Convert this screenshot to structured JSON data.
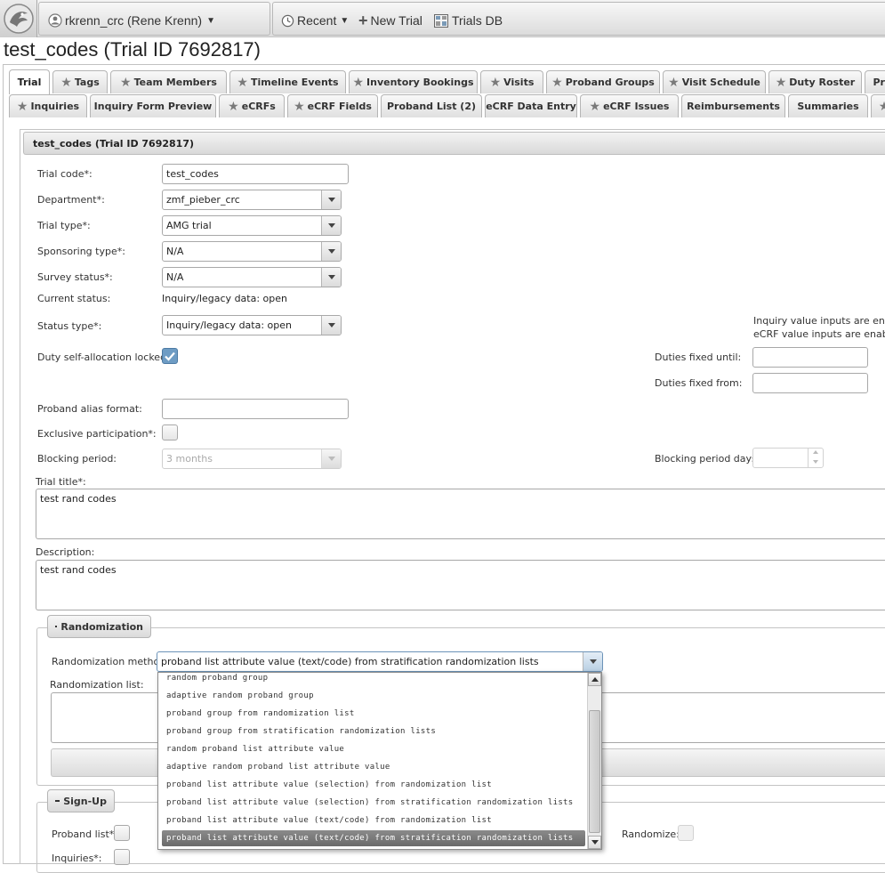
{
  "topbar": {
    "user": "rkrenn_crc (Rene Krenn)",
    "recent": "Recent",
    "new_trial": "New Trial",
    "trials_db": "Trials DB"
  },
  "page_title": "test_codes (Trial ID 7692817)",
  "tabs_row1": [
    "Trial",
    "Tags",
    "Team Members",
    "Timeline Events",
    "Inventory Bookings",
    "Visits",
    "Proband Groups",
    "Visit Schedule",
    "Duty Roster",
    "Pro"
  ],
  "tabs_row2": [
    "Inquiries",
    "Inquiry Form Preview",
    "eCRFs",
    "eCRF Fields",
    "Proband List (2)",
    "eCRF Data Entry",
    "eCRF Issues",
    "Reimbursements",
    "Summaries"
  ],
  "active_tab": "Trial",
  "section_title": "test_codes (Trial ID 7692817)",
  "form": {
    "trial_code_label": "Trial code*:",
    "trial_code_value": "test_codes",
    "department_label": "Department*:",
    "department_value": "zmf_pieber_crc",
    "trial_type_label": "Trial type*:",
    "trial_type_value": "AMG trial",
    "sponsoring_label": "Sponsoring type*:",
    "sponsoring_value": "N/A",
    "survey_label": "Survey status*:",
    "survey_value": "N/A",
    "current_status_label": "Current status:",
    "current_status_value": "Inquiry/legacy data: open",
    "status_type_label": "Status type*:",
    "status_type_value": "Inquiry/legacy data: open",
    "status_note_1": "Inquiry value inputs are enable",
    "status_note_2": "eCRF value inputs are enabled",
    "duty_locked_label": "Duty self-allocation locked*:",
    "duty_locked_checked": true,
    "duties_until_label": "Duties fixed until:",
    "duties_from_label": "Duties fixed from:",
    "alias_label": "Proband alias format:",
    "alias_value": "",
    "exclusive_label": "Exclusive participation*:",
    "exclusive_checked": false,
    "blocking_label": "Blocking period:",
    "blocking_value": "3 months",
    "blocking_days_label": "Blocking period days:",
    "title_label": "Trial title*:",
    "title_value": "test rand codes",
    "description_label": "Description:",
    "description_value": "test rand codes"
  },
  "randomization": {
    "legend": "Randomization",
    "method_label": "Randomization method:",
    "method_value": "proband list attribute value (text/code) from stratification randomization lists",
    "list_label": "Randomization list:",
    "options": [
      "random proband group",
      "adaptive random proband group",
      "proband group from randomization list",
      "proband group from stratification randomization lists",
      "random proband list attribute value",
      "adaptive random proband list attribute value",
      "proband list attribute value (selection) from randomization list",
      "proband list attribute value (selection) from stratification randomization lists",
      "proband list attribute value (text/code) from randomization list",
      "proband list attribute value (text/code) from stratification randomization lists"
    ]
  },
  "signup": {
    "legend": "Sign-Up",
    "proband_list_label": "Proband list*:",
    "inquiries_label": "Inquiries*:",
    "randomize_label": "Randomize:"
  }
}
